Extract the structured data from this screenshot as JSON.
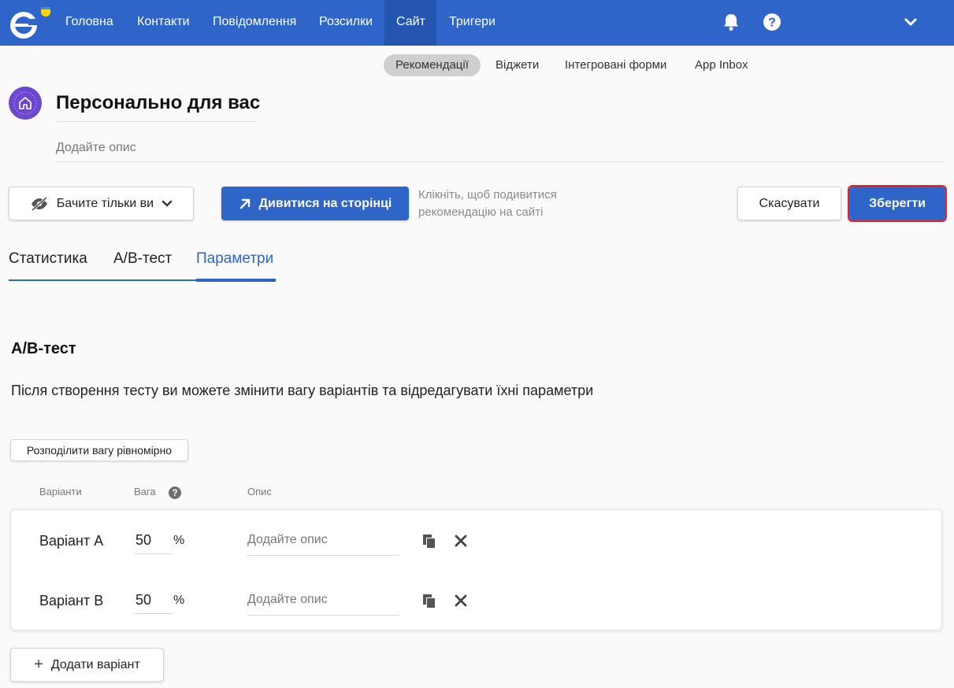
{
  "nav": {
    "items": [
      {
        "label": "Головна"
      },
      {
        "label": "Контакти"
      },
      {
        "label": "Повідомлення"
      },
      {
        "label": "Розсилки"
      },
      {
        "label": "Сайт"
      },
      {
        "label": "Тригери"
      }
    ],
    "active": "Сайт",
    "icons": [
      "bell-icon",
      "help-icon",
      "chevron-down-icon"
    ],
    "color": "#2f65c8"
  },
  "subnav": {
    "items": [
      {
        "label": "Рекомендації"
      },
      {
        "label": "Віджети"
      },
      {
        "label": "Інтегровані форми"
      },
      {
        "label": "App Inbox"
      }
    ],
    "active": "Рекомендації"
  },
  "header": {
    "title": "Персонально для вас",
    "description_placeholder": "Додайте опис"
  },
  "toolbar": {
    "visibility_label": "Бачите тільки ви",
    "view_label": "Дивитися на сторінці",
    "hint": "Клікніть, щоб подивитися рекомендацію на сайті",
    "cancel_label": "Скасувати",
    "save_label": "Зберегти"
  },
  "tabs": {
    "items": [
      {
        "label": "Статистика"
      },
      {
        "label": "A/B-тест"
      },
      {
        "label": "Параметри"
      }
    ],
    "active": "Параметри"
  },
  "ab_test": {
    "title": "A/B-тест",
    "description": "Після створення тесту ви можете змінити вагу варіантів та відредагувати їхні параметри",
    "split_button": "Розподілити вагу рівномірно",
    "columns": {
      "variants": "Варіанти",
      "weight": "Вага",
      "description": "Опис"
    },
    "variants": [
      {
        "name": "Варіант A",
        "weight": "50",
        "unit": "%",
        "description_placeholder": "Додайте опис"
      },
      {
        "name": "Варіант B",
        "weight": "50",
        "unit": "%",
        "description_placeholder": "Додайте опис"
      }
    ],
    "add_button": "Додати варіант"
  }
}
